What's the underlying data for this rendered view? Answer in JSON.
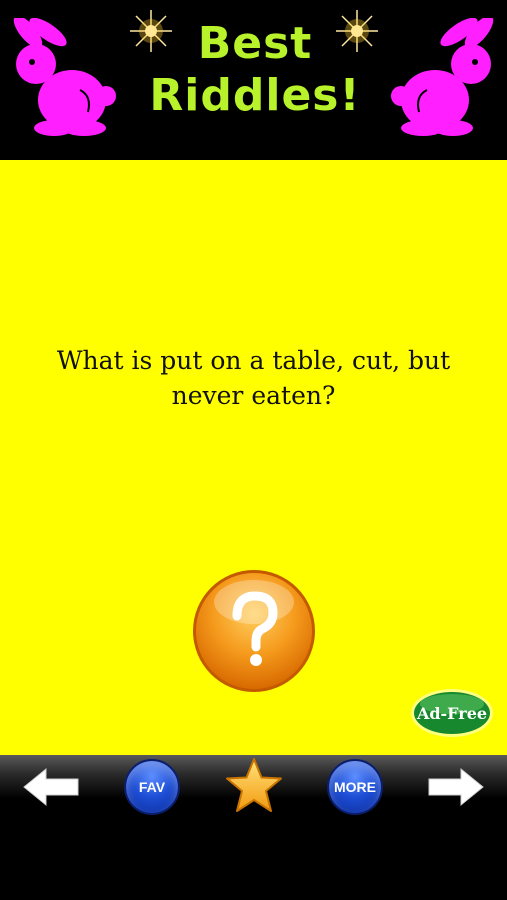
{
  "header": {
    "title_line1": "Best",
    "title_line2": "Riddles!",
    "title_color": "#b8f22a",
    "bunny_color": "#ff1fff",
    "left_bunny_icon": "rabbit-icon",
    "right_bunny_icon": "rabbit-icon",
    "sparkle_icon": "sparkle-icon"
  },
  "main": {
    "background_color": "#ffff00",
    "riddle_text": "What is put on a table, cut, but never eaten?",
    "answer_icon": "question-mark-icon",
    "adfree_label": "Ad-Free"
  },
  "toolbar": {
    "back_icon": "arrow-left-icon",
    "fav_label": "FAV",
    "star_icon": "star-icon",
    "more_label": "MORE",
    "next_icon": "arrow-right-icon"
  }
}
